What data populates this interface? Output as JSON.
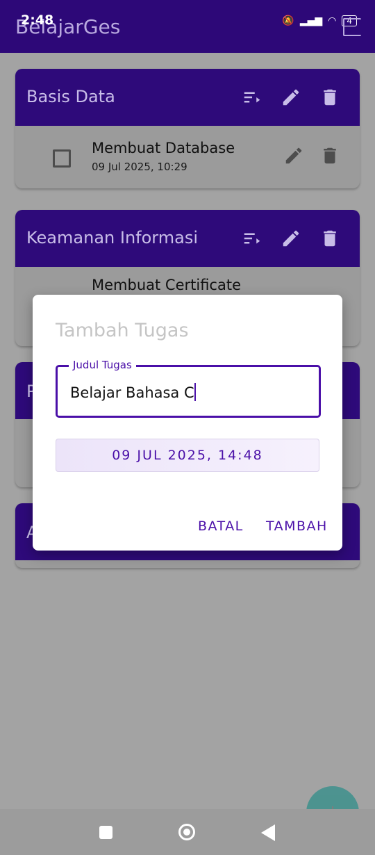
{
  "status_bar": {
    "time": "2:48",
    "battery": "4"
  },
  "app": {
    "title": "BelajarGes"
  },
  "categories": [
    {
      "name": "Basis Data",
      "tasks": [
        {
          "title": "Membuat Database",
          "date": "09 Jul 2025, 10:29"
        }
      ]
    },
    {
      "name": "Keamanan Informasi",
      "tasks": [
        {
          "title": "Membuat Certificate"
        }
      ]
    }
  ],
  "hidden_card_initials": [
    "P",
    "A"
  ],
  "dialog": {
    "title": "Tambah Tugas",
    "field_label": "Judul Tugas",
    "field_value": "Belajar Bahasa C",
    "date_value": "09 JUL 2025, 14:48",
    "cancel_label": "BATAL",
    "add_label": "TAMBAH"
  },
  "colors": {
    "primary": "#4a0fa8",
    "app_bar": "#2d0878",
    "fab": "#1f8b85"
  }
}
